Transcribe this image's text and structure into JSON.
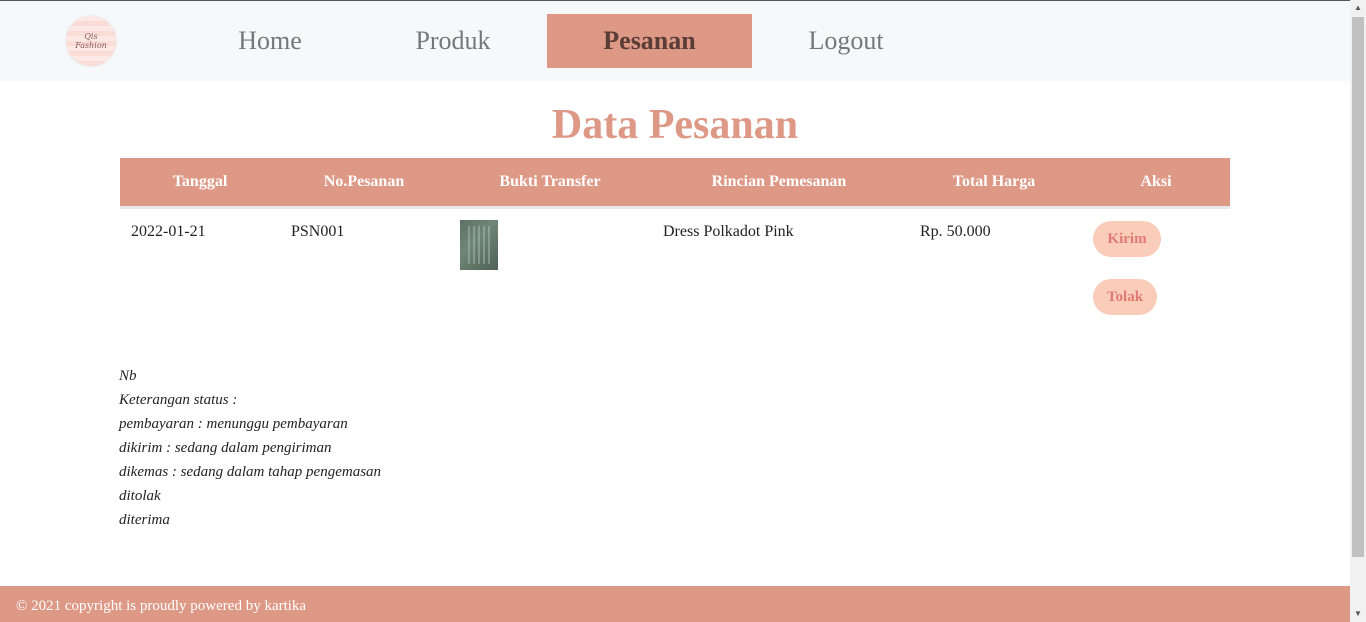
{
  "logo": {
    "line1": "Qis",
    "line2": "Fashion"
  },
  "nav": {
    "home": "Home",
    "produk": "Produk",
    "pesanan": "Pesanan",
    "logout": "Logout"
  },
  "page_title": "Data Pesanan",
  "table": {
    "headers": {
      "tanggal": "Tanggal",
      "no_pesanan": "No.Pesanan",
      "bukti": "Bukti Transfer",
      "rincian": "Rincian Pemesanan",
      "total": "Total Harga",
      "aksi": "Aksi"
    },
    "rows": [
      {
        "tanggal": "2022-01-21",
        "no_pesanan": "PSN001",
        "rincian": "Dress Polkadot Pink",
        "total": "Rp. 50.000",
        "kirim_label": "Kirim",
        "tolak_label": "Tolak"
      }
    ]
  },
  "notes": [
    "Nb",
    "Keterangan status :",
    "pembayaran : menunggu pembayaran",
    "dikirim : sedang dalam pengiriman",
    "dikemas : sedang dalam tahap pengemasan",
    "ditolak",
    "diterima"
  ],
  "footer": {
    "text": "© 2021 copyright is proudly powered by kartika"
  },
  "colors": {
    "accent": "#dd9886",
    "button_bg": "#f9cdb9",
    "button_text": "#e07a72",
    "navbar_bg": "#f7f8fa"
  },
  "icons": {
    "scroll_up": "▲",
    "scroll_down": "▼"
  }
}
